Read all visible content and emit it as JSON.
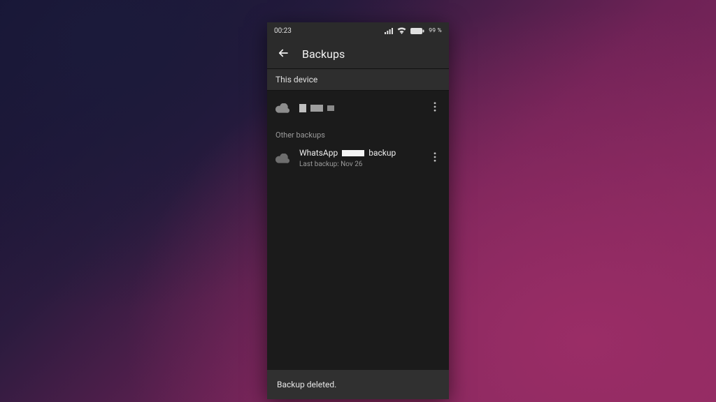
{
  "status": {
    "time": "00:23",
    "battery_text": "99 %"
  },
  "appbar": {
    "title": "Backups"
  },
  "sections": {
    "this_device": "This device",
    "other": "Other backups"
  },
  "device_backup": {
    "name_redacted": true
  },
  "other_backups": [
    {
      "name_prefix": "WhatsApp",
      "name_suffix": "backup",
      "subtitle": "Last backup: Nov 26"
    }
  ],
  "snackbar": {
    "text": "Backup deleted."
  }
}
